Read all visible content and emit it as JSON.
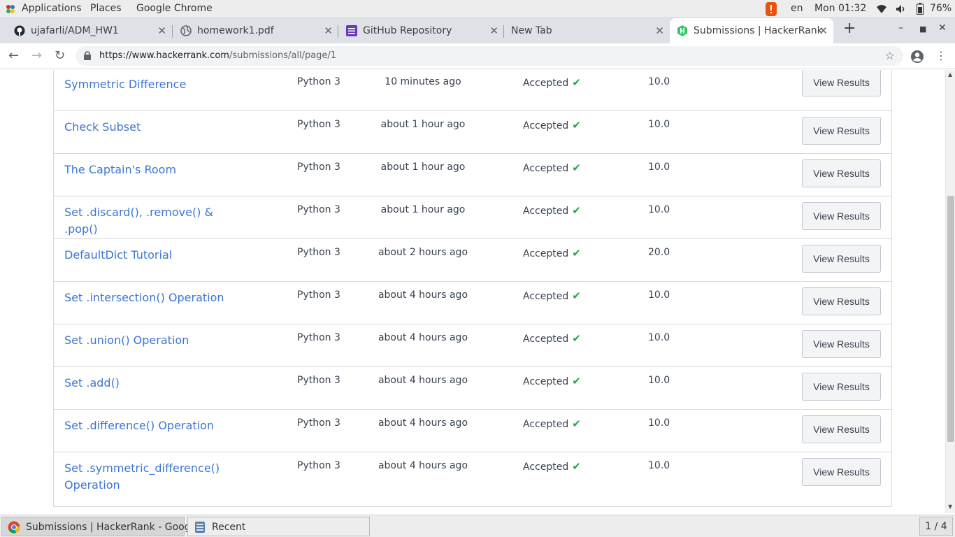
{
  "topbar": {
    "menu": [
      "Applications",
      "Places",
      "Google Chrome"
    ],
    "lang": "en",
    "clock": "Mon 01:32",
    "battery": "76%"
  },
  "tabs": [
    {
      "title": "ujafarli/ADM_HW1",
      "icon": "github-icon"
    },
    {
      "title": "homework1.pdf",
      "icon": "globe-icon"
    },
    {
      "title": "GitHub Repository",
      "icon": "forms-icon"
    },
    {
      "title": "New Tab",
      "icon": ""
    },
    {
      "title": "Submissions | HackerRank",
      "icon": "hackerrank-icon"
    }
  ],
  "url": {
    "host": "https://www.hackerrank.com",
    "path": "/submissions/all/page/1"
  },
  "submissions": [
    {
      "name": "Symmetric Difference",
      "lang": "Python 3",
      "time": "10 minutes ago",
      "status": "Accepted",
      "score": "10.0",
      "action": "View Results"
    },
    {
      "name": "Check Subset",
      "lang": "Python 3",
      "time": "about 1 hour ago",
      "status": "Accepted",
      "score": "10.0",
      "action": "View Results"
    },
    {
      "name": "The Captain's Room",
      "lang": "Python 3",
      "time": "about 1 hour ago",
      "status": "Accepted",
      "score": "10.0",
      "action": "View Results"
    },
    {
      "name": "Set .discard(), .remove() & .pop()",
      "lang": "Python 3",
      "time": "about 1 hour ago",
      "status": "Accepted",
      "score": "10.0",
      "action": "View Results"
    },
    {
      "name": "DefaultDict Tutorial",
      "lang": "Python 3",
      "time": "about 2 hours ago",
      "status": "Accepted",
      "score": "20.0",
      "action": "View Results"
    },
    {
      "name": "Set .intersection() Operation",
      "lang": "Python 3",
      "time": "about 4 hours ago",
      "status": "Accepted",
      "score": "10.0",
      "action": "View Results"
    },
    {
      "name": "Set .union() Operation",
      "lang": "Python 3",
      "time": "about 4 hours ago",
      "status": "Accepted",
      "score": "10.0",
      "action": "View Results"
    },
    {
      "name": "Set .add()",
      "lang": "Python 3",
      "time": "about 4 hours ago",
      "status": "Accepted",
      "score": "10.0",
      "action": "View Results"
    },
    {
      "name": "Set .difference() Operation",
      "lang": "Python 3",
      "time": "about 4 hours ago",
      "status": "Accepted",
      "score": "10.0",
      "action": "View Results"
    },
    {
      "name": "Set .symmetric_difference() Operation",
      "lang": "Python 3",
      "time": "about 4 hours ago",
      "status": "Accepted",
      "score": "10.0",
      "action": "View Results"
    }
  ],
  "taskbar": {
    "windows": [
      "Submissions | HackerRank - Google...",
      "Recent"
    ],
    "pager": "1 / 4"
  }
}
